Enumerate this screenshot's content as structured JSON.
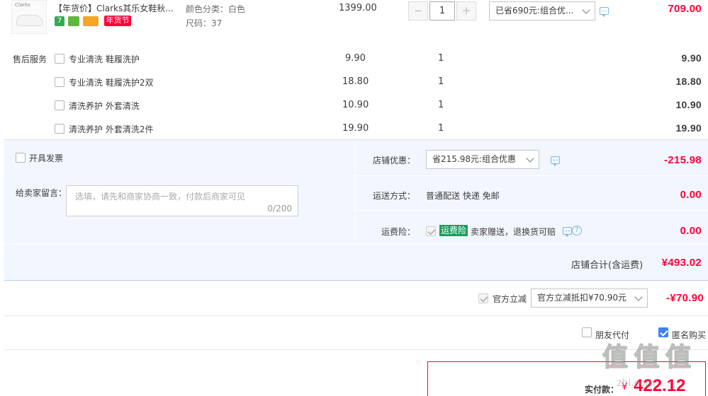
{
  "product": {
    "title": "【年货价】Clarks其乐女鞋秋...",
    "thumb_brand": "Clarks",
    "tag_seven": "7",
    "tag_festival": "年货节",
    "spec_color": "颜色分类：白色",
    "spec_size": "尺码：37",
    "unit_price": "1399.00",
    "quantity": "1",
    "qty_minus": "−",
    "qty_plus": "+",
    "promo_select": "已省690元:组合优...",
    "subtotal": "709.00"
  },
  "after_sales": {
    "label": "售后服务",
    "items": [
      {
        "name": "专业清洗 鞋履洗护",
        "price": "9.90",
        "qty": "1",
        "subtotal": "9.90"
      },
      {
        "name": "专业清洗 鞋履洗护2双",
        "price": "18.80",
        "qty": "1",
        "subtotal": "18.80"
      },
      {
        "name": "清洗养护 外套清洗",
        "price": "10.90",
        "qty": "1",
        "subtotal": "10.90"
      },
      {
        "name": "清洗养护 外套清洗2件",
        "price": "19.90",
        "qty": "1",
        "subtotal": "19.90"
      }
    ]
  },
  "order": {
    "invoice_label": "开具发票",
    "message_label": "给卖家留言：",
    "message_placeholder": "选填，请先和商家协商一致，付款后商家可见",
    "message_count": "0/200",
    "store_discount_label": "店铺优惠：",
    "store_discount_select": "省215.98元:组合优惠",
    "store_discount_amount": "-215.98",
    "shipping_label": "运送方式：",
    "shipping_value": "普通配送 快递 免邮",
    "shipping_amount": "0.00",
    "insurance_label": "运费险：",
    "insurance_tag": "运费险",
    "insurance_desc": "卖家赠送，退换货可赔",
    "insurance_amount": "0.00",
    "store_total_label": "店铺合计(含运费)",
    "store_total_amount": "¥493.02"
  },
  "official": {
    "label": "官方立减",
    "select": "官方立减抵扣¥70.90元",
    "amount": "-¥70.90"
  },
  "options": {
    "friend_pay": "朋友代付",
    "anonymous": "匿名购买"
  },
  "payment": {
    "label": "实付款：",
    "currency": "¥",
    "amount": "422.12"
  },
  "watermark": {
    "text": "值 值 值",
    "url": "zhi.com"
  },
  "colors": {
    "accent_red": "#ff0036",
    "section_bg": "#f2f6fe",
    "checkbox_blue": "#3d81ff",
    "tag_green": "#1a9d5c"
  }
}
